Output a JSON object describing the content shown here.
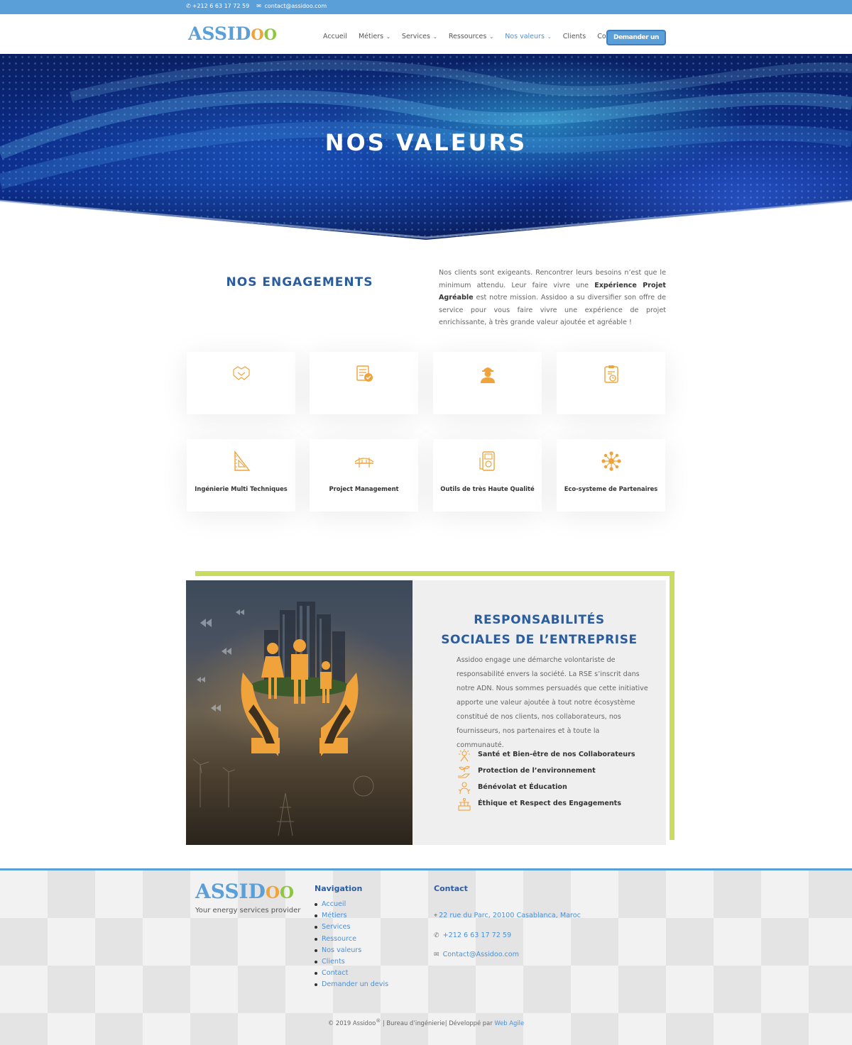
{
  "topbar": {
    "phone": "+212 6 63 17 72 59",
    "email": "contact@assidoo.com"
  },
  "brand": {
    "name_part1": "ASSID",
    "name_part2": "O",
    "name_part3": "O",
    "tagline": "Your energy services provider"
  },
  "nav": {
    "items": [
      {
        "label": "Accueil",
        "dropdown": false,
        "active": false
      },
      {
        "label": "Métiers",
        "dropdown": true,
        "active": false
      },
      {
        "label": "Services",
        "dropdown": true,
        "active": false
      },
      {
        "label": "Ressources",
        "dropdown": true,
        "active": false
      },
      {
        "label": "Nos valeurs",
        "dropdown": true,
        "active": true
      },
      {
        "label": "Clients",
        "dropdown": false,
        "active": false
      },
      {
        "label": "Contact",
        "dropdown": false,
        "active": false
      }
    ],
    "cta_label": "Demander un devis"
  },
  "hero": {
    "title": "NOS VALEURS"
  },
  "engagements": {
    "title": "NOS ENGAGEMENTS",
    "text_part1": "Nos clients sont exigeants. Rencontrer leurs besoins n’est que le minimum attendu. Leur faire vivre une ",
    "text_bold": "Expérience Projet Agréable",
    "text_part2": " est notre mission. Assidoo a su diversifier son offre de service pour vous faire vivre une expérience de projet enrichissante, à très grande valeur ajoutée et agréable !",
    "cards_row1": [
      {
        "icon": "handshake-icon",
        "label": ""
      },
      {
        "icon": "checklist-icon",
        "label": ""
      },
      {
        "icon": "engineer-icon",
        "label": ""
      },
      {
        "icon": "clipboard-clock-icon",
        "label": ""
      }
    ],
    "cards_row2": [
      {
        "icon": "ruler-triangle-icon",
        "label": "Ingénierie Multi Techniques"
      },
      {
        "icon": "bridge-icon",
        "label": "Project Management"
      },
      {
        "icon": "multimeter-icon",
        "label": "Outils de très Haute Qualité"
      },
      {
        "icon": "network-icon",
        "label": "Eco-systeme de Partenaires"
      }
    ]
  },
  "rse": {
    "title_line1": "RESPONSABILITÉS",
    "title_line2": "SOCIALES DE L’ENTREPRISE",
    "text": "Assidoo engage une démarche volontariste de responsabilité envers la société. La RSE s’inscrit dans notre ADN. Nous sommes persuadés que cette initiative apporte une valeur ajoutée à tout notre écosystème constitué de nos clients, nos collaborateurs, nos fournisseurs, nos partenaires et à toute la communauté.",
    "list": [
      {
        "icon": "wellbeing-icon",
        "label": "Santé et Bien-être de nos Collaborateurs"
      },
      {
        "icon": "plant-hand-icon",
        "label": "Protection de l’environnement"
      },
      {
        "icon": "volunteer-icon",
        "label": "Bénévolat et Éducation"
      },
      {
        "icon": "ethics-icon",
        "label": "Éthique et Respect des Engagements"
      }
    ]
  },
  "footer": {
    "nav_title": "Navigation",
    "nav_items": [
      "Accueil",
      "Métiers",
      "Services",
      "Ressource",
      "Nos valeurs",
      "Clients",
      "Contact",
      "Demander un devis"
    ],
    "contact_title": "Contact",
    "address": "22 rue du Parc, 20100 Casablanca, Maroc",
    "phone": "+212 6 63 17 72 59",
    "email": "Contact@Assidoo.com",
    "copyright_prefix": "© 2019 Assidoo",
    "copyright_suffix": " | Bureau d’ingénierie| Développé par ",
    "credit_link": "Web Agile"
  },
  "colors": {
    "accent_blue": "#5b9fd8",
    "title_blue": "#2b5c9e",
    "icon_orange": "#f0a33b",
    "lime": "#c9dc5f"
  }
}
